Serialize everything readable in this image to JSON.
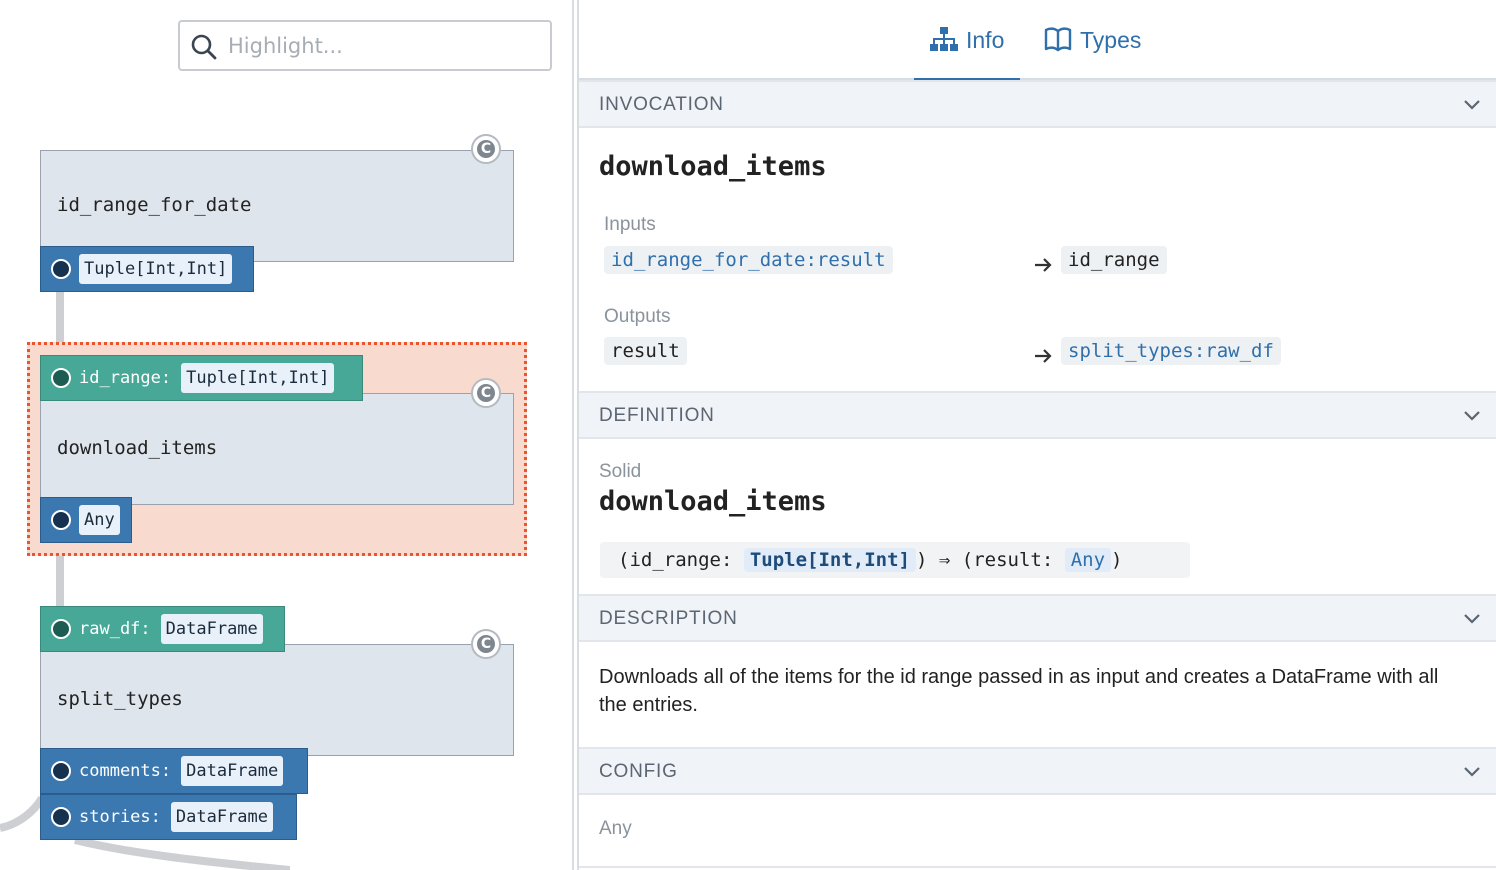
{
  "search": {
    "placeholder": "Highlight..."
  },
  "graph": {
    "nodes": [
      {
        "title": "id_range_for_date",
        "badge": "C",
        "outputs": [
          {
            "name": "",
            "type": "Tuple[Int,Int]"
          }
        ]
      },
      {
        "title": "download_items",
        "badge": "C",
        "selected": true,
        "inputs": [
          {
            "name": "id_range:",
            "type": "Tuple[Int,Int]"
          }
        ],
        "outputs": [
          {
            "name": "",
            "type": "Any"
          }
        ]
      },
      {
        "title": "split_types",
        "badge": "C",
        "inputs": [
          {
            "name": "raw_df:",
            "type": "DataFrame"
          }
        ],
        "outputs": [
          {
            "name": "comments:",
            "type": "DataFrame"
          },
          {
            "name": "stories:",
            "type": "DataFrame"
          }
        ]
      }
    ]
  },
  "sidebar": {
    "tabs": [
      {
        "label": "Info",
        "icon": "sitemap-icon",
        "active": true
      },
      {
        "label": "Types",
        "icon": "book-icon",
        "active": false
      }
    ],
    "invocation": {
      "header": "INVOCATION",
      "name": "download_items",
      "inputs_label": "Inputs",
      "inputs": [
        {
          "source": "id_range_for_date:result",
          "target": "id_range"
        }
      ],
      "outputs_label": "Outputs",
      "outputs": [
        {
          "source": "result",
          "target": "split_types:raw_df"
        }
      ]
    },
    "definition": {
      "header": "DEFINITION",
      "kind": "Solid",
      "name": "download_items",
      "sig_open": "(id_range: ",
      "sig_in_type": "Tuple[Int,Int]",
      "sig_mid": ") ⇒ (result: ",
      "sig_out_type": "Any",
      "sig_close": ")"
    },
    "description": {
      "header": "DESCRIPTION",
      "text": "Downloads all of the items for the id range passed in as input and creates a DataFrame with all the entries."
    },
    "config": {
      "header": "CONFIG",
      "value": "Any"
    }
  },
  "colors": {
    "accent": "#2f6fab",
    "selection": "#f9dacf",
    "selection_border": "#e8552e",
    "output_port": "#3c78b0",
    "input_port": "#48a898"
  }
}
